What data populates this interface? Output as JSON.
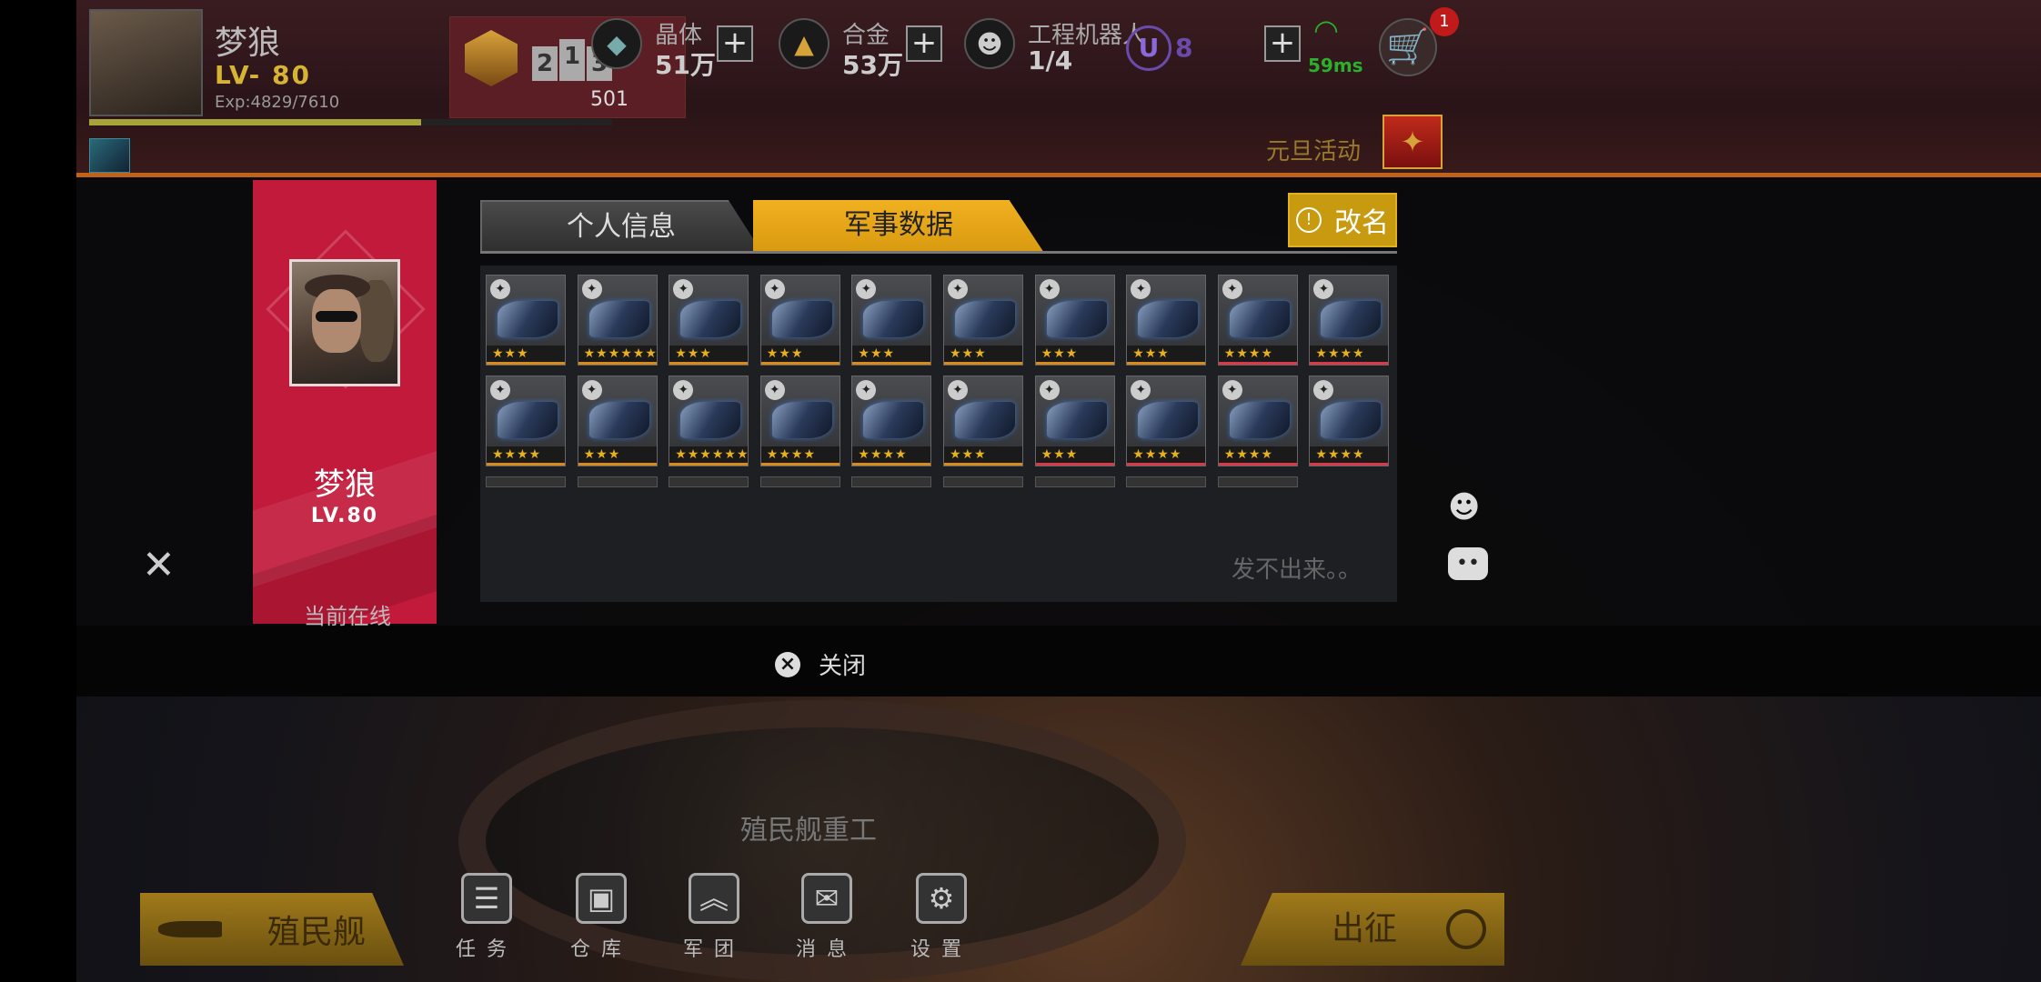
{
  "player": {
    "name": "梦狼",
    "level": "LV- 80",
    "exp": "Exp:4829/7610",
    "exp_fraction": 0.634
  },
  "rank": {
    "podium": [
      "2",
      "1",
      "3"
    ],
    "score": "501"
  },
  "resources": [
    {
      "label": "晶体",
      "value": "51万",
      "icon": "crystal-icon"
    },
    {
      "label": "合金",
      "value": "53万",
      "icon": "alloy-icon"
    },
    {
      "label": "工程机器人",
      "value": "1/4",
      "icon": "robot-icon"
    }
  ],
  "currency": {
    "symbol": "U",
    "value": "8"
  },
  "network": {
    "ping": "59ms"
  },
  "cart_badge": "1",
  "event_label": "元旦活动",
  "profile": {
    "name": "梦狼",
    "level": "LV.80",
    "status": "当前在线"
  },
  "tabs": {
    "personal": "个人信息",
    "military": "军事数据"
  },
  "rename_label": "改名",
  "ships": [
    {
      "stars": "★★★",
      "rarity": "#d88a1a"
    },
    {
      "stars": "★★★★★★",
      "rarity": "#d88a1a"
    },
    {
      "stars": "★★★",
      "rarity": "#d88a1a"
    },
    {
      "stars": "★★★",
      "rarity": "#d88a1a"
    },
    {
      "stars": "★★★",
      "rarity": "#d88a1a"
    },
    {
      "stars": "★★★",
      "rarity": "#d88a1a"
    },
    {
      "stars": "★★★",
      "rarity": "#d88a1a"
    },
    {
      "stars": "★★★",
      "rarity": "#d88a1a"
    },
    {
      "stars": "★★★★",
      "rarity": "#d83a4a"
    },
    {
      "stars": "★★★★",
      "rarity": "#d83a4a"
    },
    {
      "stars": "★★★★",
      "rarity": "#d88a1a"
    },
    {
      "stars": "★★★",
      "rarity": "#d88a1a"
    },
    {
      "stars": "★★★★★★",
      "rarity": "#d88a1a"
    },
    {
      "stars": "★★★★",
      "rarity": "#d88a1a"
    },
    {
      "stars": "★★★★",
      "rarity": "#d88a1a"
    },
    {
      "stars": "★★★",
      "rarity": "#d88a1a"
    },
    {
      "stars": "★★★",
      "rarity": "#d83a4a"
    },
    {
      "stars": "★★★★",
      "rarity": "#d83a4a"
    },
    {
      "stars": "★★★★",
      "rarity": "#d83a4a"
    },
    {
      "stars": "★★★★",
      "rarity": "#d83a4a"
    }
  ],
  "close_label": "关闭",
  "bottom": {
    "ship_label": "殖民舰重工",
    "chat_text": "发不出来。。",
    "colony_button": "殖民舰",
    "sortie_button": "出征",
    "nav": [
      {
        "label": "任务",
        "icon": "mission-icon"
      },
      {
        "label": "仓库",
        "icon": "warehouse-icon"
      },
      {
        "label": "军团",
        "icon": "legion-icon"
      },
      {
        "label": "消息",
        "icon": "message-icon"
      },
      {
        "label": "设置",
        "icon": "settings-icon"
      }
    ]
  },
  "colors": {
    "accent": "#f0b020",
    "panel_red": "#c21a3a",
    "ping_green": "#2ab02a"
  }
}
